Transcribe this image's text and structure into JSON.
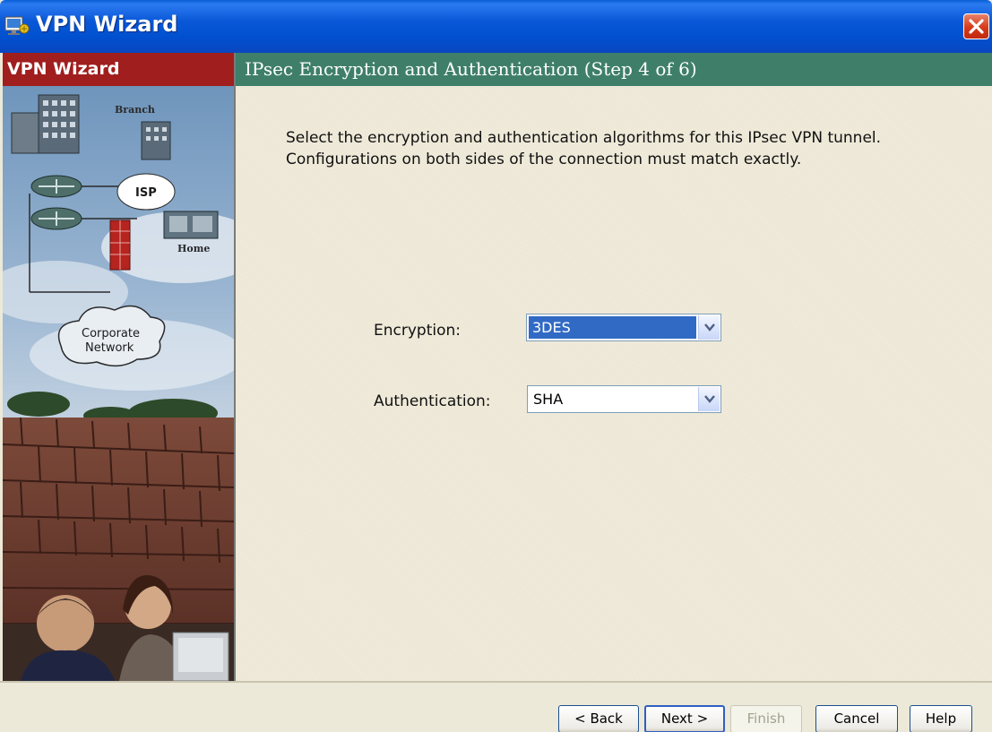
{
  "window": {
    "title": "VPN Wizard",
    "icons": {
      "app": "vpn-wizard-app-icon",
      "close": "close-icon"
    }
  },
  "left_panel": {
    "header": "VPN Wizard",
    "illustration_labels": {
      "branch": "Branch",
      "isp": "ISP",
      "home": "Home",
      "corporate_line1": "Corporate",
      "corporate_line2": "Network"
    }
  },
  "step": {
    "title": "IPsec Encryption and Authentication   (Step 4 of 6)"
  },
  "content": {
    "description_line1": "Select the encryption and authentication algorithms for this IPsec VPN tunnel.",
    "description_line2": "Configurations on both sides of the connection must match exactly.",
    "encryption": {
      "label": "Encryption:",
      "value": "3DES"
    },
    "authentication": {
      "label": "Authentication:",
      "value": "SHA"
    }
  },
  "footer": {
    "back": "< Back",
    "next": "Next >",
    "finish": "Finish",
    "cancel": "Cancel",
    "help": "Help"
  },
  "colors": {
    "titlebar": "#0a58d8",
    "left_header": "#a01e1e",
    "step_header": "#3f7f6a",
    "content_bg": "#ede8d6",
    "selection": "#316ac5"
  }
}
